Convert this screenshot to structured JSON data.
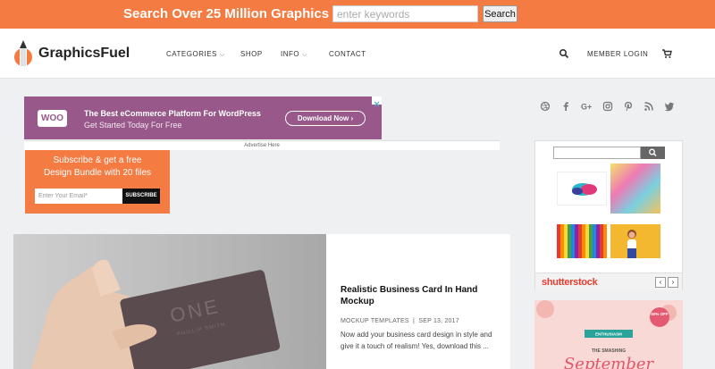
{
  "topbar": {
    "headline": "Search Over 25 Million Graphics",
    "search_placeholder": "enter keywords",
    "search_button": "Search"
  },
  "header": {
    "logo_text": "GraphicsFuel",
    "nav": {
      "categories": "CATEGORIES",
      "shop": "SHOP",
      "info": "INFO",
      "contact": "CONTACT",
      "member_login": "MEMBER LOGIN"
    },
    "icons": [
      "search-icon",
      "cart-icon",
      "chevron-down-icon"
    ]
  },
  "ad_banner": {
    "logo": "WOO",
    "title": "The Best eCommerce Platform For WordPress",
    "subtitle": "Get Started Today For Free",
    "button": "Download Now",
    "label": "Advertise Here"
  },
  "subscribe": {
    "line1": "Subscribe & get a free",
    "line2": "Design Bundle with 20 files",
    "email_placeholder": "Enter Your Email*",
    "button": "SUBSCRIBE"
  },
  "post": {
    "title": "Realistic Business Card In Hand Mockup",
    "category": "MOCKUP TEMPLATES",
    "separator": "|",
    "date": "SEP 13, 2017",
    "excerpt": "Now add your business card design in style and give it a touch of realism! Yes, download this ...",
    "card_brand": "ONE",
    "card_name": "PHILLIP SMITH"
  },
  "sidebar": {
    "social_icons": [
      "dribbble-icon",
      "facebook-icon",
      "google-plus-icon",
      "instagram-icon",
      "pinterest-icon",
      "rss-icon",
      "twitter-icon"
    ],
    "shutterstock_logo": "shutterstock",
    "prev": "‹",
    "next": "›",
    "ad2_badge": "50% OFF",
    "ad2_ribbon": "ENTHUSIASM",
    "ad2_sub": "THE SMASHING",
    "ad2_month": "September"
  },
  "colors": {
    "brand_orange": "#f47b42",
    "woo_purple": "#98588a",
    "shutterstock_red": "#e83c2f"
  }
}
